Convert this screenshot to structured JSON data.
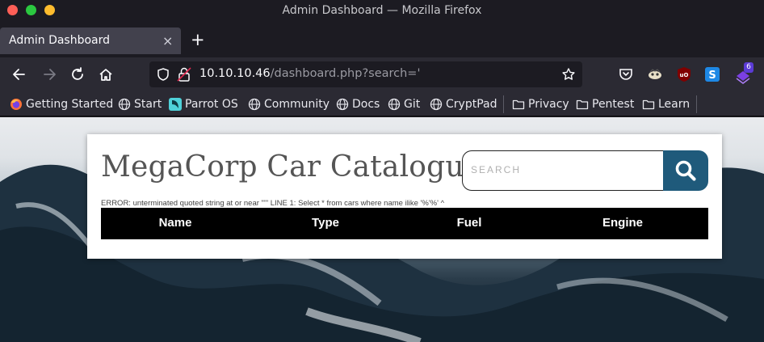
{
  "window": {
    "title": "Admin Dashboard — Mozilla Firefox"
  },
  "tab": {
    "label": "Admin Dashboard",
    "close_glyph": "×",
    "new_tab_glyph": "+"
  },
  "url": {
    "host": "10.10.10.46",
    "path": "/dashboard.php?search='"
  },
  "toolbar": {
    "extension_badge": "6"
  },
  "bookmarks": [
    {
      "label": "Getting Started",
      "icon": "firefox-icon"
    },
    {
      "label": "Start",
      "icon": "globe-icon"
    },
    {
      "label": "Parrot OS",
      "icon": "parrot-icon"
    },
    {
      "label": "Community",
      "icon": "globe-icon"
    },
    {
      "label": "Docs",
      "icon": "globe-icon"
    },
    {
      "label": "Git",
      "icon": "globe-icon"
    },
    {
      "label": "CryptPad",
      "icon": "globe-icon"
    },
    {
      "label": "Privacy",
      "icon": "folder-icon"
    },
    {
      "label": "Pentest",
      "icon": "folder-icon"
    },
    {
      "label": "Learn",
      "icon": "folder-icon"
    }
  ],
  "page": {
    "title": "MegaCorp Car Catalogue",
    "search_placeholder": "SEARCH",
    "error": "ERROR: unterminated quoted string at or near \"'\" LINE 1: Select * from cars where name ilike '%'%' ^",
    "columns": [
      "Name",
      "Type",
      "Fuel",
      "Engine"
    ]
  },
  "colors": {
    "search_button": "#1f5a7b",
    "table_header": "#000000",
    "firefox_bg": "#1c1b22"
  }
}
